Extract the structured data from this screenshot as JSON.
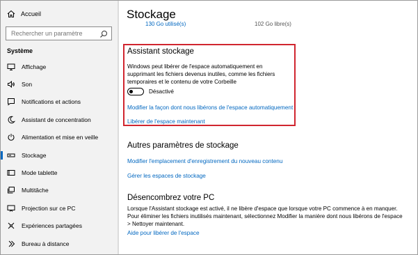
{
  "sidebar": {
    "home_label": "Accueil",
    "search_placeholder": "Rechercher un paramètre",
    "section_title": "Système",
    "items": [
      {
        "label": "Affichage",
        "icon": "display-icon",
        "active": false
      },
      {
        "label": "Son",
        "icon": "speaker-icon",
        "active": false
      },
      {
        "label": "Notifications et actions",
        "icon": "notification-icon",
        "active": false
      },
      {
        "label": "Assistant de concentration",
        "icon": "moon-icon",
        "active": false
      },
      {
        "label": "Alimentation et mise en veille",
        "icon": "power-icon",
        "active": false
      },
      {
        "label": "Stockage",
        "icon": "storage-icon",
        "active": true
      },
      {
        "label": "Mode tablette",
        "icon": "tablet-icon",
        "active": false
      },
      {
        "label": "Multitâche",
        "icon": "multitask-icon",
        "active": false
      },
      {
        "label": "Projection sur ce PC",
        "icon": "projection-icon",
        "active": false
      },
      {
        "label": "Expériences partagées",
        "icon": "shared-icon",
        "active": false
      },
      {
        "label": "Bureau à distance",
        "icon": "remote-icon",
        "active": false
      }
    ]
  },
  "main": {
    "title": "Stockage",
    "used": "130 Go utilisé(s)",
    "free": "102 Go libre(s)",
    "storage_sense": {
      "title": "Assistant stockage",
      "description": "Windows peut libérer de l'espace automatiquement en supprimant les fichiers devenus inutiles, comme les fichiers temporaires et le contenu de votre Corbeille",
      "toggle_state": "Désactivé",
      "toggle_on": false,
      "link_change": "Modifier la façon dont nous libérons de l'espace automatiquement",
      "link_free_now": "Libérer de l'espace maintenant"
    },
    "more_settings": {
      "title": "Autres paramètres de stockage",
      "link_save_location": "Modifier l'emplacement d'enregistrement du nouveau contenu",
      "link_spaces": "Gérer les espaces de stockage"
    },
    "declutter": {
      "title": "Désencombrez votre PC",
      "description": "Lorsque l'Assistant stockage est activé, il ne libère d'espace que lorsque votre PC commence à en manquer. Pour éliminer les fichiers inutilisés maintenant, sélectionnez Modifier la manière dont nous libérons de l'espace > Nettoyer maintenant.",
      "link_help": "Aide pour libérer de l'espace"
    }
  },
  "colors": {
    "accent": "#0067c0",
    "highlight_border": "#d0252f",
    "sidebar_bg": "#f2f2f2"
  }
}
